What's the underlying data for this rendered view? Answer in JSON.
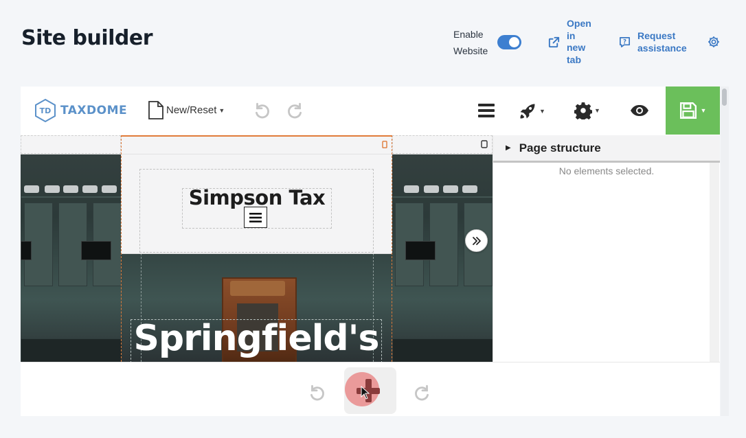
{
  "header": {
    "title": "Site builder",
    "enable_label": "Enable Website",
    "enable_state": "on",
    "open_new_tab": "Open in new tab",
    "request_assistance": "Request assistance",
    "accent_color": "#3d7fd0"
  },
  "editor": {
    "logo_text": "TAXDOME",
    "new_reset_label": "New/Reset",
    "icons": [
      "undo-icon",
      "redo-icon",
      "menu-icon",
      "rocket-icon",
      "gear-icon",
      "eye-icon",
      "save-icon"
    ],
    "save_color": "#6bbf5b"
  },
  "canvas": {
    "brand_name": "Simpson Tax",
    "hero_title": "Springfield's",
    "selection_color": "#e07b39"
  },
  "structure_panel": {
    "title": "Page structure",
    "empty_text": "No elements selected."
  },
  "bottom": {
    "add_icon": "plus-icon"
  }
}
